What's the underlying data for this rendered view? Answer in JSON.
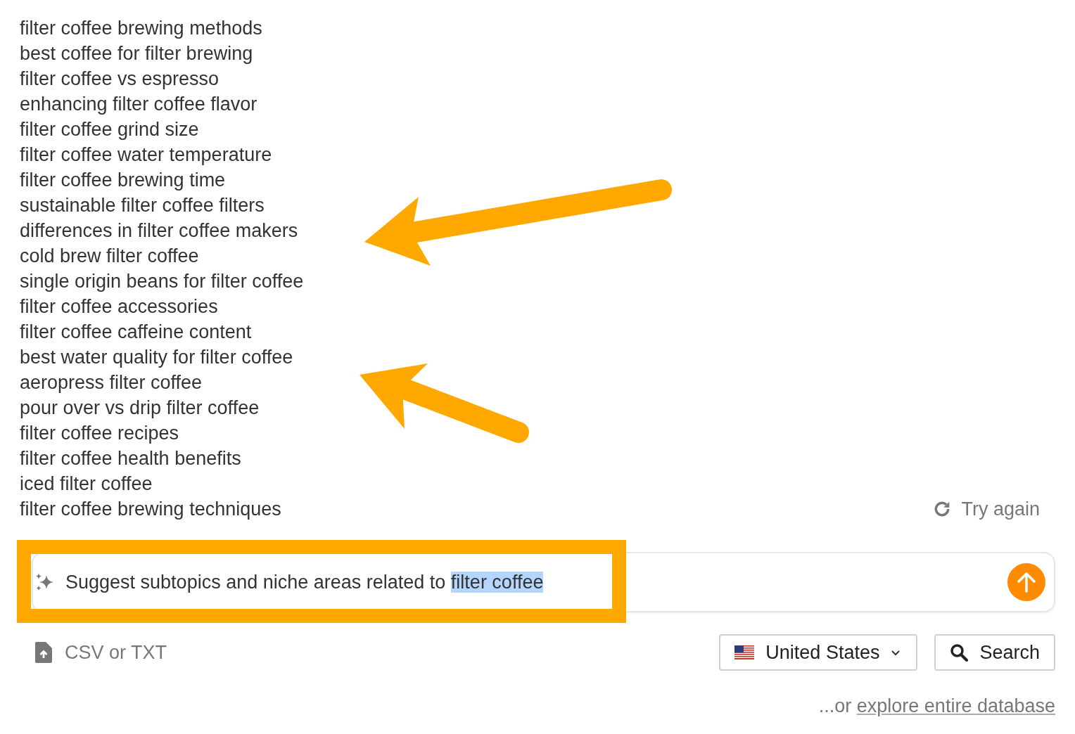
{
  "suggestions": [
    {
      "text": "filter coffee brewing methods"
    },
    {
      "text": "best coffee for filter brewing"
    },
    {
      "text": "filter coffee vs espresso"
    },
    {
      "text": "enhancing filter coffee flavor"
    },
    {
      "text": "filter coffee grind size"
    },
    {
      "text": "filter coffee water temperature"
    },
    {
      "text": "filter coffee brewing time"
    },
    {
      "text": "sustainable filter coffee filters"
    },
    {
      "text": "differences in filter coffee makers"
    },
    {
      "text": "cold brew filter coffee"
    },
    {
      "text": "single origin beans for filter coffee"
    },
    {
      "text": "filter coffee accessories"
    },
    {
      "text": "filter coffee caffeine content"
    },
    {
      "text": "best water quality for filter coffee"
    },
    {
      "text": "aeropress filter coffee"
    },
    {
      "text": "pour over vs drip filter coffee"
    },
    {
      "text": "filter coffee recipes"
    },
    {
      "text": "filter coffee health benefits"
    },
    {
      "text": "iced filter coffee"
    },
    {
      "text": "filter coffee brewing techniques"
    }
  ],
  "try_again": "Try again",
  "prompt": {
    "text": "Suggest subtopics and niche areas related to ",
    "selected_text": "filter coffee"
  },
  "upload": "CSV or TXT",
  "country": "United States",
  "search_button": "Search",
  "footer": {
    "prefix": "...or ",
    "link": "explore entire database"
  }
}
